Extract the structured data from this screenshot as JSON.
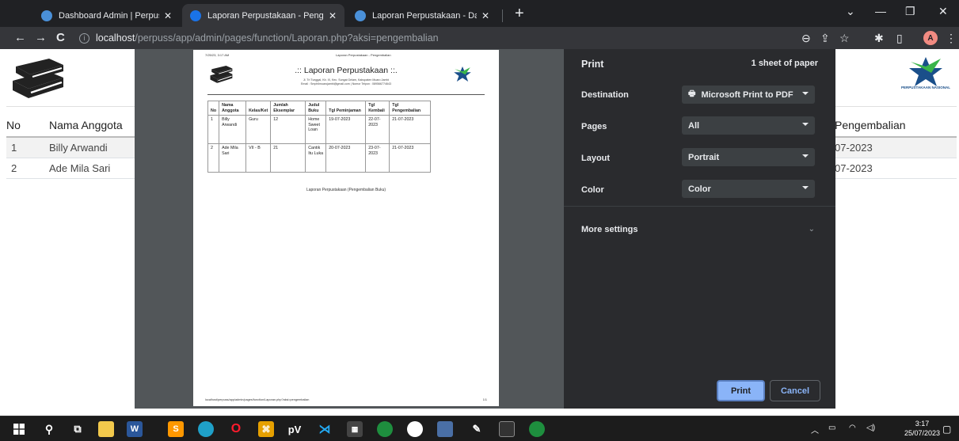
{
  "tabs": [
    {
      "title": "Dashboard Admin | Perpustakaan",
      "close": "✕"
    },
    {
      "title": "Laporan Perpustakaan - Pengembalian",
      "close": "✕"
    },
    {
      "title": "Laporan Perpustakaan - Data Buku",
      "close": "✕"
    }
  ],
  "newtab": "+",
  "window": {
    "minimize": "—",
    "restore": "❐",
    "close": "✕",
    "dropdown": "⌄"
  },
  "toolbar": {
    "back": "←",
    "forward": "→",
    "reload": "C",
    "info": "i",
    "url_host": "localhost",
    "url_path": "/perpuss/app/admin/pages/function/Laporan.php?aksi=pengembalian",
    "zoom": "⊖",
    "share": "⇪",
    "star": "☆",
    "ext": "✱",
    "sidebar": "▯",
    "profile": "A",
    "menu": "⋮"
  },
  "bg_table": {
    "headers": [
      "No",
      "Nama Anggota",
      "Pengembalian"
    ],
    "rows": [
      {
        "no": "1",
        "nama": "Billy Arwandi",
        "tgl": "07-2023"
      },
      {
        "no": "2",
        "nama": "Ade Mila Sari",
        "tgl": "07-2023"
      }
    ]
  },
  "logo": {
    "caption": "PERPUSTAKAAN NASIONAL"
  },
  "paper": {
    "header_left": "7/25/23, 3:17 AM",
    "header_center": "Laporan Perpustakaan - Pengembalian",
    "title": ".:: Laporan Perpustakaan ::.",
    "address1": "Jl. Tri Tunggal, Kb. IX, Kec. Sungai Gelam, Kabupaten Muaro Jambi",
    "address2": "Email : Smphilmuarojambi@gmail.com | Nomor Telpon : 089566774643",
    "headers": [
      "No",
      "Nama Anggota",
      "Kelas/Ket",
      "Jumlah Eksemplar",
      "Judul Buku",
      "Tgl Peminjaman",
      "Tgl Kembali",
      "Tgl Pengembalian"
    ],
    "rows": [
      [
        "1",
        "Billy Arwandi",
        "Guru",
        "12",
        "Home Sweet Loan",
        "19-07-2023",
        "22-07-2023",
        "21-07-2023"
      ],
      [
        "2",
        "Ade Mila Sari",
        "VII - B",
        "21",
        "Cantik Itu Luka",
        "20-07-2023",
        "23-07-2023",
        "21-07-2023"
      ]
    ],
    "caption": "Laporan Perpustakaan (Pengembalian Buku)",
    "footer_url": "localhost/perpuss/app/admin/pages/function/Laporan.php?aksi=pengembalian",
    "footer_page": "1/1"
  },
  "print": {
    "title": "Print",
    "sheets": "1 sheet of paper",
    "destination_label": "Destination",
    "destination_value": "Microsoft Print to PDF",
    "pages_label": "Pages",
    "pages_value": "All",
    "layout_label": "Layout",
    "layout_value": "Portrait",
    "color_label": "Color",
    "color_value": "Color",
    "more_settings": "More settings",
    "print_button": "Print",
    "cancel_button": "Cancel"
  },
  "taskbar": {
    "time": "3:17",
    "date": "25/07/2023",
    "icons": [
      "windows-start-icon",
      "search-icon",
      "task-view-icon",
      "file-explorer-icon",
      "word-icon",
      "sublime-icon",
      "edge-icon",
      "opera-icon",
      "app-icon",
      "pv-icon",
      "vscode-icon",
      "calendar-app-icon",
      "chrome-icon",
      "app2-icon",
      "app3-icon",
      "app4-icon",
      "terminal-icon",
      "chrome-profile-icon"
    ]
  },
  "colors": {
    "accent": "#8ab4f8",
    "dark_panel": "#2a2b2e",
    "preview_bg": "#525659",
    "tabbar": "#202124"
  }
}
